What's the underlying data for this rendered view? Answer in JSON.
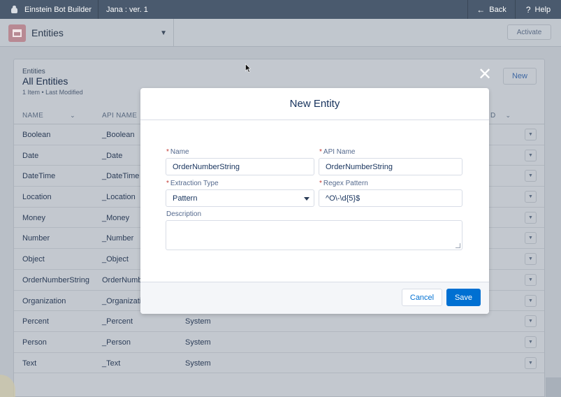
{
  "topbar": {
    "app_name": "Einstein Bot Builder",
    "version": "Jana : ver. 1",
    "back_label": "Back",
    "help_label": "Help"
  },
  "subbar": {
    "entity_selector": "Entities",
    "activate_label": "Activate"
  },
  "card": {
    "breadcrumb": "Entities",
    "title": "All Entities",
    "meta": "1 Item • Last Modified",
    "new_label": "New",
    "columns": [
      "NAME",
      "API NAME",
      "D"
    ],
    "rows": [
      {
        "name": "Boolean",
        "api": "_Boolean",
        "type": ""
      },
      {
        "name": "Date",
        "api": "_Date",
        "type": ""
      },
      {
        "name": "DateTime",
        "api": "_DateTime",
        "type": ""
      },
      {
        "name": "Location",
        "api": "_Location",
        "type": ""
      },
      {
        "name": "Money",
        "api": "_Money",
        "type": ""
      },
      {
        "name": "Number",
        "api": "_Number",
        "type": ""
      },
      {
        "name": "Object",
        "api": "_Object",
        "type": ""
      },
      {
        "name": "OrderNumberString",
        "api": "OrderNumb",
        "type": ""
      },
      {
        "name": "Organization",
        "api": "_Organizatio",
        "type": ""
      },
      {
        "name": "Percent",
        "api": "_Percent",
        "type": "System"
      },
      {
        "name": "Person",
        "api": "_Person",
        "type": "System"
      },
      {
        "name": "Text",
        "api": "_Text",
        "type": "System"
      }
    ]
  },
  "modal": {
    "title": "New Entity",
    "name_label": "Name",
    "name_value": "OrderNumberString",
    "api_label": "API Name",
    "api_value": "OrderNumberString",
    "extraction_label": "Extraction Type",
    "extraction_value": "Pattern",
    "regex_label": "Regex Pattern",
    "regex_value": "^O\\-\\d{5}$",
    "description_label": "Description",
    "description_value": "",
    "cancel_label": "Cancel",
    "save_label": "Save",
    "close_glyph": "✕"
  },
  "colors": {
    "brand_blue": "#0070d2",
    "required_red": "#c23934",
    "topbar": "#4a5a6e"
  }
}
